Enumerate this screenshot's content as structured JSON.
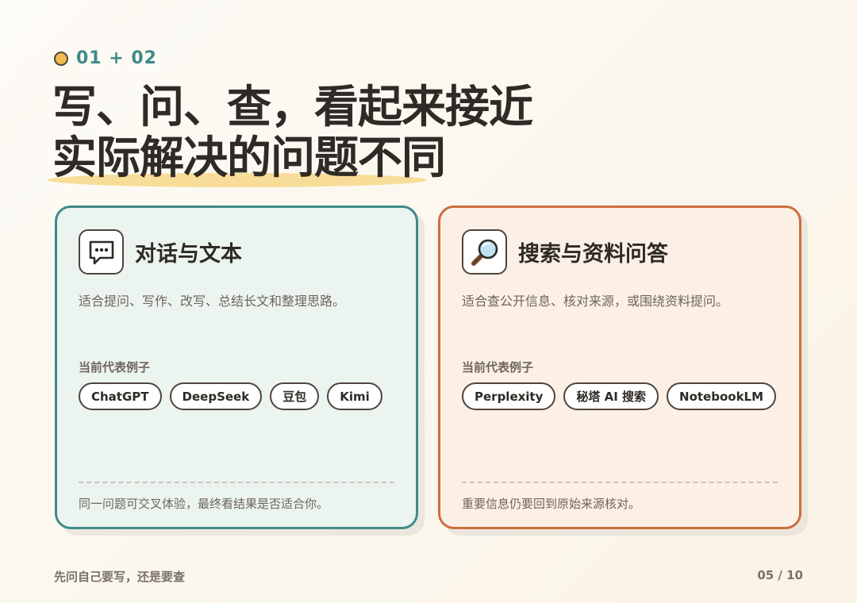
{
  "eyebrow": {
    "label": "01 + 02"
  },
  "title": {
    "line1": "写、问、查，看起来接近",
    "line2": "实际解决的问题不同"
  },
  "cards": [
    {
      "icon": "speech-bubble-icon",
      "title": "对话与文本",
      "desc": "适合提问、写作、改写、总结长文和整理思路。",
      "examples_label": "当前代表例子",
      "chips": [
        "ChatGPT",
        "DeepSeek",
        "豆包",
        "Kimi"
      ],
      "foot": "同一问题可交叉体验，最终看结果是否适合你。",
      "accent": "#3f8a88"
    },
    {
      "icon": "magnifier-icon",
      "title": "搜索与资料问答",
      "desc": "适合查公开信息、核对来源，或围绕资料提问。",
      "examples_label": "当前代表例子",
      "chips": [
        "Perplexity",
        "秘塔 AI 搜索",
        "NotebookLM"
      ],
      "foot": "重要信息仍要回到原始来源核对。",
      "accent": "#cc6e3f"
    }
  ],
  "footer": {
    "left": "先问自己要写，还是要查",
    "page": "05 / 10"
  }
}
